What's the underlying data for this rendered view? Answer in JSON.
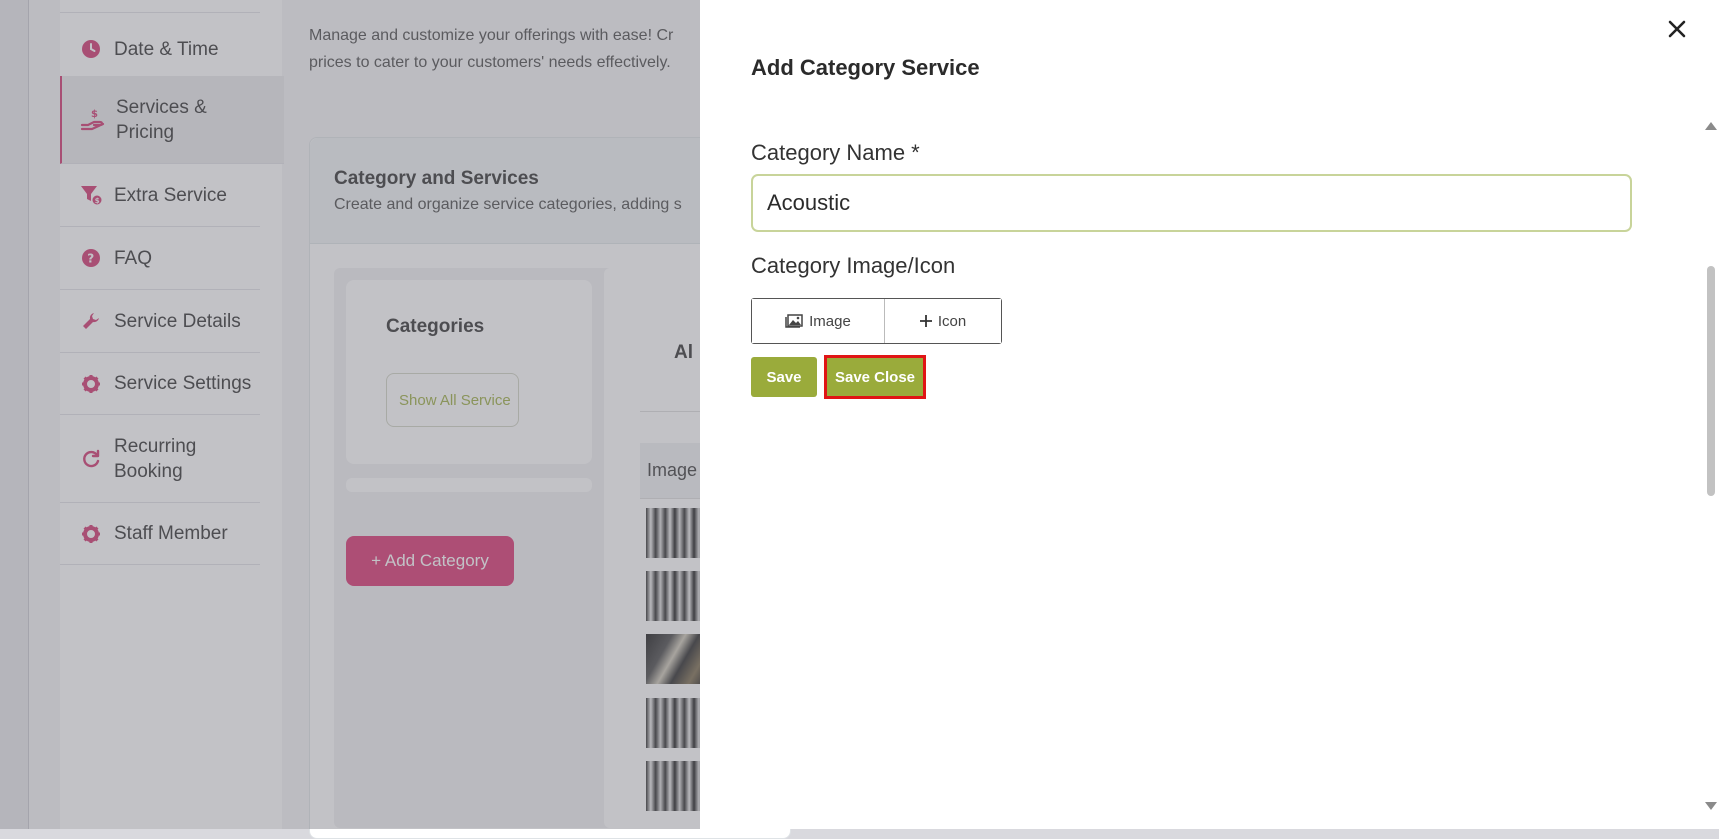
{
  "sidebar": {
    "items": [
      {
        "label": "Date & Time",
        "icon": "clock-icon"
      },
      {
        "label": "Services & Pricing",
        "icon": "hand-dollar-icon",
        "active": true
      },
      {
        "label": "Extra Service",
        "icon": "filter-dollar-icon"
      },
      {
        "label": "FAQ",
        "icon": "question-circle-icon"
      },
      {
        "label": "Service Details",
        "icon": "wrench-icon"
      },
      {
        "label": "Service Settings",
        "icon": "gear-icon"
      },
      {
        "label": "Recurring Booking",
        "icon": "refresh-icon"
      },
      {
        "label": "Staff Member",
        "icon": "gear-icon"
      }
    ]
  },
  "main": {
    "subtitle": "Manage and customize your offerings with ease! Cr prices to cater to your customers' needs effectively.",
    "card": {
      "title": "Category and Services",
      "description": "Create and organize service categories, adding s",
      "categories_title": "Categories",
      "show_all_label": "Show All Service",
      "add_category_label": "+ Add Category",
      "all_label": "Al",
      "image_column_header": "Image"
    }
  },
  "drawer": {
    "title": "Add Category Service",
    "category_name_label": "Category Name *",
    "category_name_value": "Acoustic",
    "image_icon_label": "Category Image/Icon",
    "image_button_label": "Image",
    "icon_button_label": "Icon",
    "save_label": "Save",
    "save_close_label": "Save Close"
  },
  "colors": {
    "brand_pink": "#d92c6c",
    "accent_olive": "#9aab3b",
    "highlight_red": "#e01515"
  }
}
